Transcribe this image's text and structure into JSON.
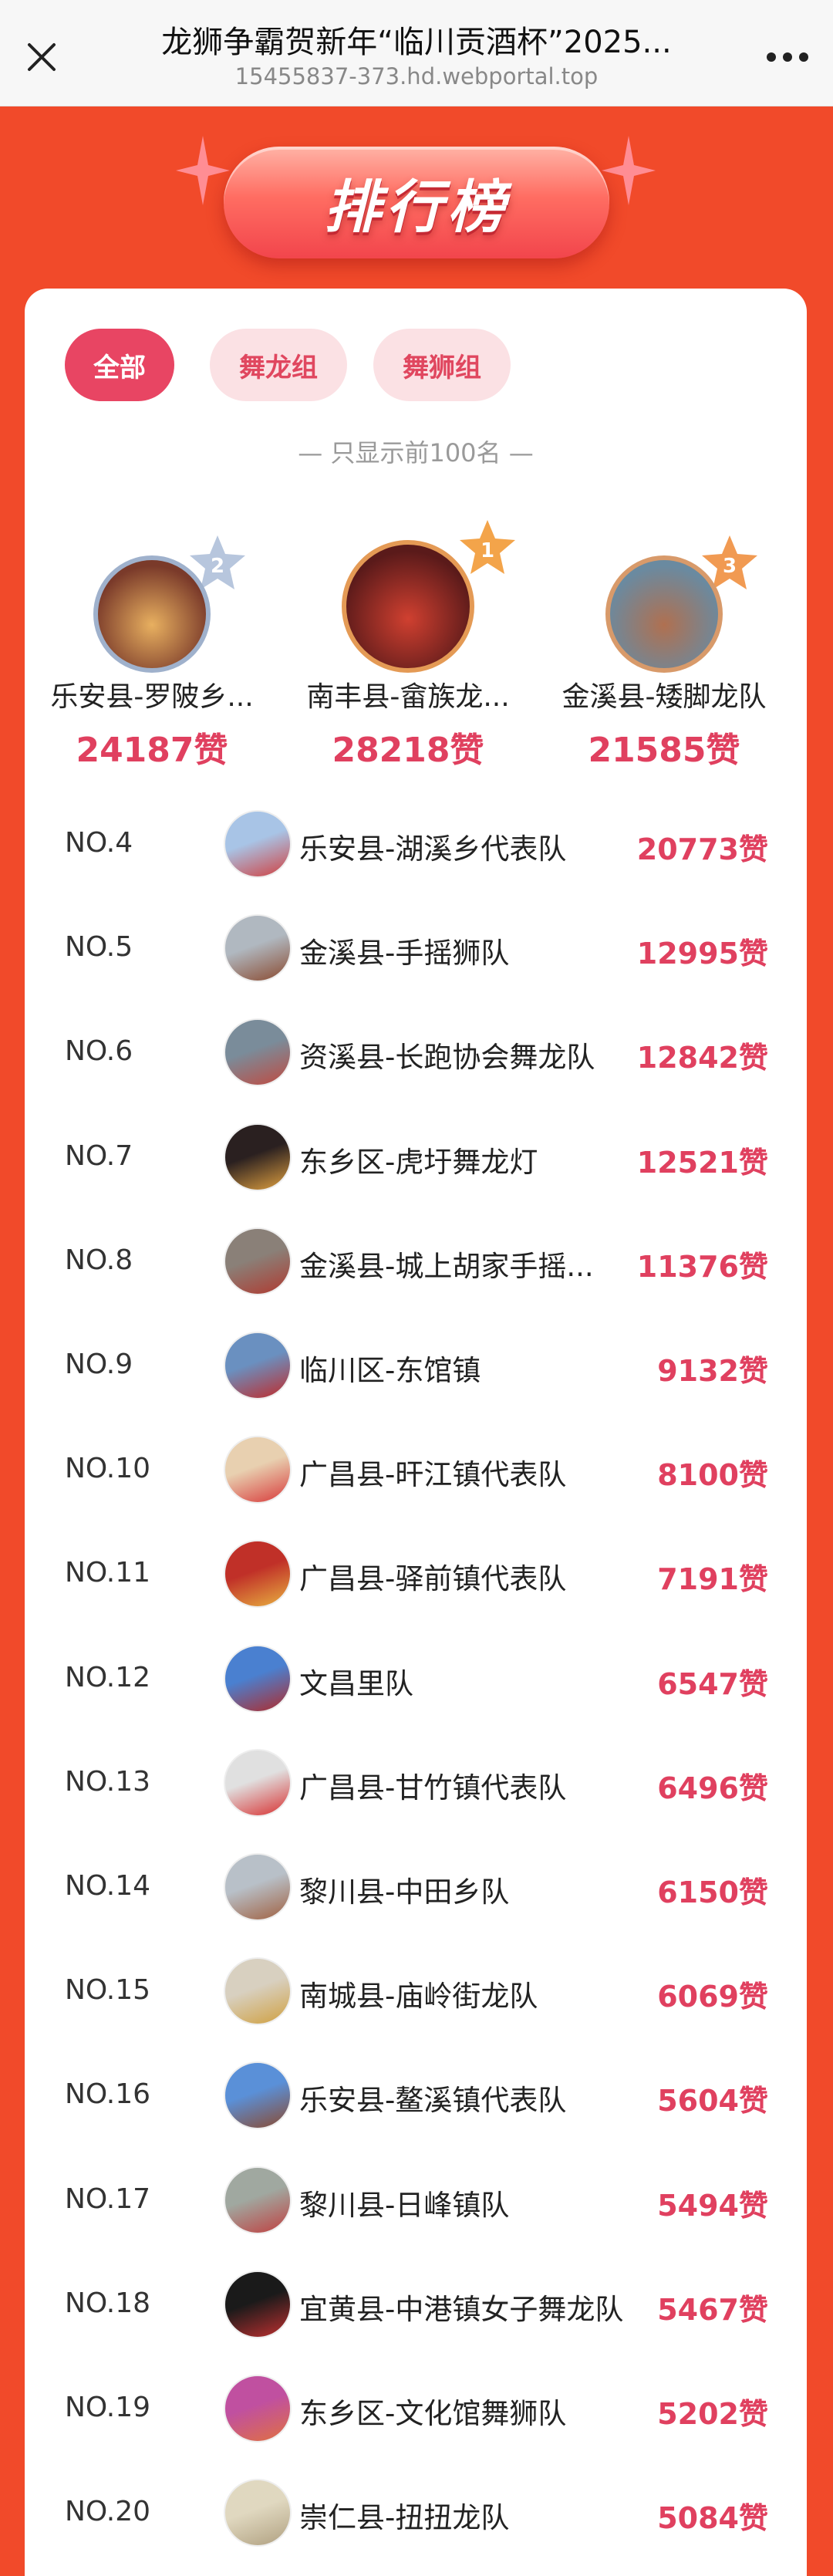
{
  "browser": {
    "title": "龙狮争霸贺新年“临川贡酒杯”2025...",
    "url": "15455837-373.hd.webportal.top",
    "close_icon": "close-icon",
    "more_icon": "more-icon"
  },
  "banner": {
    "title": "排行榜"
  },
  "tabs": [
    {
      "label": "全部",
      "active": true
    },
    {
      "label": "舞龙组",
      "active": false
    },
    {
      "label": "舞狮组",
      "active": false
    }
  ],
  "notice": "— 只显示前100名 —",
  "podium": [
    {
      "rank": "2",
      "name": "乐安县-罗陂乡...",
      "likes": "24187赞",
      "photo": "#7a3a2a",
      "photo2": "#e8b060"
    },
    {
      "rank": "1",
      "name": "南丰县-畲族龙...",
      "likes": "28218赞",
      "photo": "#5a1a1a",
      "photo2": "#d04030"
    },
    {
      "rank": "3",
      "name": "金溪县-矮脚龙队",
      "likes": "21585赞",
      "photo": "#6a8aa0",
      "photo2": "#b07050"
    }
  ],
  "ranking": [
    {
      "rank": "NO.4",
      "name": "乐安县-湖溪乡代表队",
      "likes": "20773赞",
      "c1": "#a8c4e6",
      "c2": "#d04040"
    },
    {
      "rank": "NO.5",
      "name": "金溪县-手摇狮队",
      "likes": "12995赞",
      "c1": "#b0b8c0",
      "c2": "#8a4a30"
    },
    {
      "rank": "NO.6",
      "name": "资溪县-长跑协会舞龙队",
      "likes": "12842赞",
      "c1": "#7a8c9a",
      "c2": "#c04a40"
    },
    {
      "rank": "NO.7",
      "name": "东乡区-虎圩舞龙灯",
      "likes": "12521赞",
      "c1": "#2a2020",
      "c2": "#e0a040"
    },
    {
      "rank": "NO.8",
      "name": "金溪县-城上胡家手摇...",
      "likes": "11376赞",
      "c1": "#8a8078",
      "c2": "#b03a30"
    },
    {
      "rank": "NO.9",
      "name": "临川区-东馆镇",
      "likes": "9132赞",
      "c1": "#6a90c0",
      "c2": "#c02a2a"
    },
    {
      "rank": "NO.10",
      "name": "广昌县-旰江镇代表队",
      "likes": "8100赞",
      "c1": "#e8d0b0",
      "c2": "#d83a3a"
    },
    {
      "rank": "NO.11",
      "name": "广昌县-驿前镇代表队",
      "likes": "7191赞",
      "c1": "#c03028",
      "c2": "#e8b040"
    },
    {
      "rank": "NO.12",
      "name": "文昌里队",
      "likes": "6547赞",
      "c1": "#4a80d0",
      "c2": "#b02a2a"
    },
    {
      "rank": "NO.13",
      "name": "广昌县-甘竹镇代表队",
      "likes": "6496赞",
      "c1": "#e0e0e0",
      "c2": "#d83030"
    },
    {
      "rank": "NO.14",
      "name": "黎川县-中田乡队",
      "likes": "6150赞",
      "c1": "#b8c0c8",
      "c2": "#a06040"
    },
    {
      "rank": "NO.15",
      "name": "南城县-庙岭街龙队",
      "likes": "6069赞",
      "c1": "#d8d0c0",
      "c2": "#d0a040"
    },
    {
      "rank": "NO.16",
      "name": "乐安县-鳌溪镇代表队",
      "likes": "5604赞",
      "c1": "#5a90d8",
      "c2": "#8a4a30"
    },
    {
      "rank": "NO.17",
      "name": "黎川县-日峰镇队",
      "likes": "5494赞",
      "c1": "#a0a8a0",
      "c2": "#c04040"
    },
    {
      "rank": "NO.18",
      "name": "宜黄县-中港镇女子舞龙队",
      "likes": "5467赞",
      "c1": "#1a1a1a",
      "c2": "#c03030"
    },
    {
      "rank": "NO.19",
      "name": "东乡区-文化馆舞狮队",
      "likes": "5202赞",
      "c1": "#c050a0",
      "c2": "#e07040"
    },
    {
      "rank": "NO.20",
      "name": "崇仁县-扭扭龙队",
      "likes": "5084赞",
      "c1": "#e0d8c0",
      "c2": "#b0a080"
    }
  ],
  "colors": {
    "page_bg": "#f14a2a",
    "accent": "#e84563",
    "likes": "#e0405f"
  }
}
